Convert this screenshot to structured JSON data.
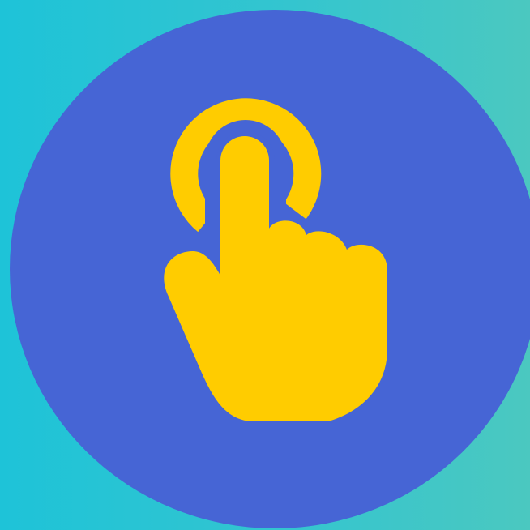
{
  "icon": {
    "name": "tap-gesture-icon",
    "color": "#ffcc00"
  },
  "colors": {
    "background_left": "#1ec3d8",
    "background_right": "#4bc8c0",
    "disc": "#4665d5",
    "accent": "#ffcc00"
  }
}
